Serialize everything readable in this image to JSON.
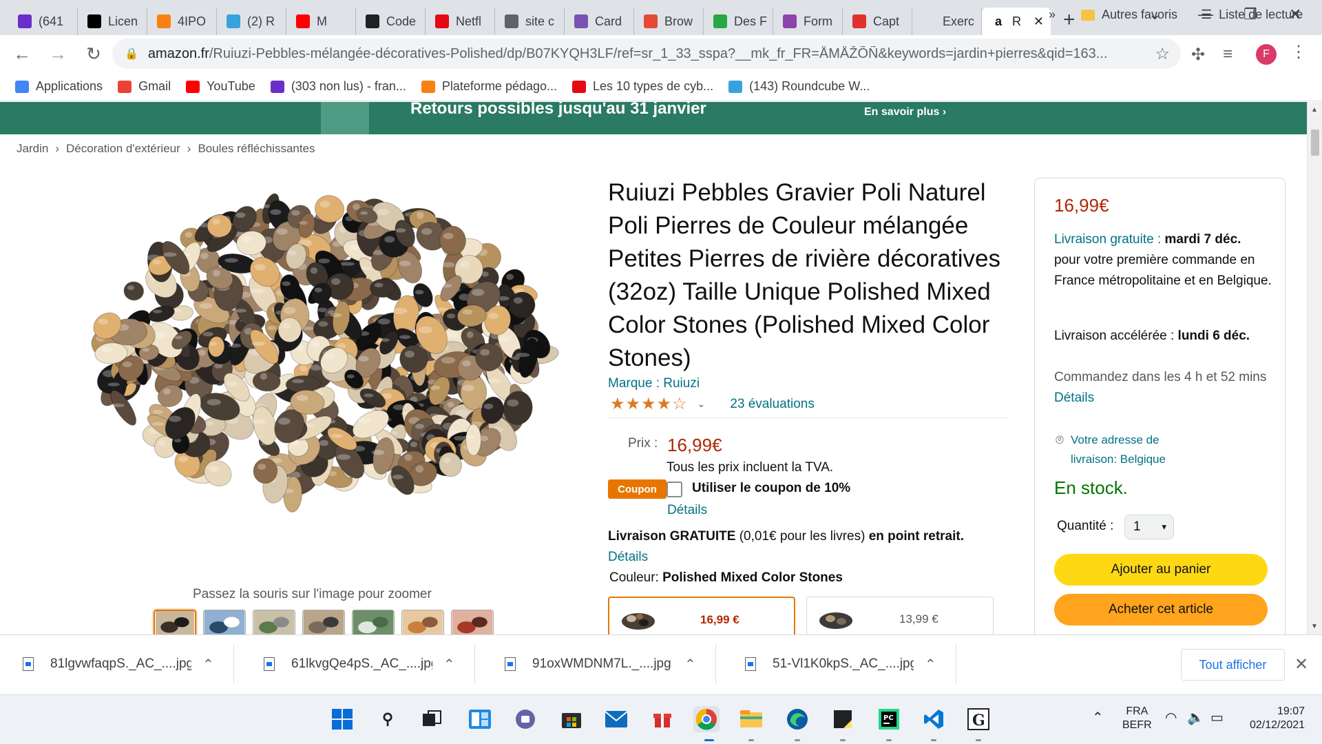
{
  "browser": {
    "tabs": [
      {
        "title": "(641",
        "icon": "mail-icon",
        "color": "#6b2fc9"
      },
      {
        "title": "Licen",
        "icon": "jb-icon",
        "color": "#000000"
      },
      {
        "title": "4IPO",
        "icon": "moodle-icon",
        "color": "#f98012"
      },
      {
        "title": "(2) R",
        "icon": "roundcube-icon",
        "color": "#37a3dc"
      },
      {
        "title": "M",
        "icon": "youtube-icon",
        "color": "#ff0000"
      },
      {
        "title": "Code",
        "icon": "codepen-icon",
        "color": "#202124"
      },
      {
        "title": "Netfl",
        "icon": "netflix-icon",
        "color": "#e50914"
      },
      {
        "title": "site c",
        "icon": "globe-icon",
        "color": "#5f6368"
      },
      {
        "title": "Card",
        "icon": "bootstrap-icon",
        "color": "#7952b3"
      },
      {
        "title": "Brow",
        "icon": "browserstack-icon",
        "color": "#e54a37"
      },
      {
        "title": "Des F",
        "icon": "px-icon",
        "color": "#28a745"
      },
      {
        "title": "Form",
        "icon": "form-icon",
        "color": "#8e44ad"
      },
      {
        "title": "Capt",
        "icon": "capture-icon",
        "color": "#e0322d"
      },
      {
        "title": "Exerc",
        "icon": "blank-icon",
        "color": "#dfe3e8"
      },
      {
        "title": "R",
        "icon": "amazon-icon",
        "color": "#ffffff",
        "active": true
      }
    ],
    "url_host": "amazon.fr",
    "url_path": "/Ruiuzi-Pebbles-mélangée-décoratives-Polished/dp/B07KYQH3LF/ref=sr_1_33_sspa?__mk_fr_FR=ÅMÅŽÕÑ&keywords=jardin+pierres&qid=163...",
    "profile_initial": "F",
    "bookmarks": [
      {
        "label": "Applications",
        "icon": "apps-grid-icon"
      },
      {
        "label": "Gmail",
        "icon": "gmail-icon"
      },
      {
        "label": "YouTube",
        "icon": "youtube-icon"
      },
      {
        "label": "(303 non lus) - fran...",
        "icon": "mail-icon"
      },
      {
        "label": "Plateforme pédago...",
        "icon": "moodle-icon"
      },
      {
        "label": "Les 10 types de cyb...",
        "icon": "horseshoe-icon"
      },
      {
        "label": "(143) Roundcube W...",
        "icon": "roundcube-icon"
      }
    ],
    "bookmarks_right": {
      "more": "»",
      "folder": "Autres favoris",
      "reading": "Liste de lecture"
    }
  },
  "banner": {
    "main": "Retours possibles jusqu'au 31 janvier",
    "more": "En savoir plus ›"
  },
  "breadcrumb": [
    "Jardin",
    "Décoration d'extérieur",
    "Boules réfléchissantes"
  ],
  "product": {
    "title": "Ruiuzi Pebbles Gravier Poli Naturel Poli Pierres de Couleur mélangée Petites Pierres de rivière décoratives (32oz) Taille Unique Polished Mixed Color Stones (Polished Mixed Color Stones)",
    "brand": "Marque : Ruiuzi",
    "stars": "★★★★☆",
    "rating": 4,
    "reviews": "23 évaluations",
    "price_label": "Prix :",
    "price": "16,99€",
    "tva": "Tous les prix incluent la TVA.",
    "coupon_badge": "Coupon",
    "coupon_text": "Utiliser le coupon de 10%",
    "coupon_details": "Détails",
    "livraison_a": "Livraison GRATUITE",
    "livraison_b": " (0,01€ pour les livres) ",
    "livraison_c": "en point retrait.",
    "livraison_details": "Détails",
    "couleur_label": "Couleur: ",
    "couleur_value": "Polished Mixed Color Stones",
    "variants": [
      {
        "price": "16,99 €",
        "selected": true
      },
      {
        "price": "13,99 €",
        "selected": false
      }
    ],
    "zoom_hint": "Passez la souris sur l'image pour zoomer",
    "thumbnail_count": 7
  },
  "buybox": {
    "price": "16,99€",
    "free_link": "Livraison gratuite :",
    "free_date": " mardi 7 déc.",
    "free_rest": "pour votre première commande en France métropolitaine et en Belgique.",
    "fast_a": "Livraison accélérée : ",
    "fast_b": "lundi 6 déc.",
    "order_a": "Commandez dans les 4 h et 52 mins ",
    "order_link": "Détails",
    "address": "Votre adresse de livraison: Belgique",
    "stock": "En stock.",
    "qty_label": "Quantité :",
    "qty_value": "1",
    "add_to_cart": "Ajouter au panier",
    "buy_now": "Acheter cet article"
  },
  "downloads": {
    "files": [
      "81lgvwfaqpS._AC_....jpg",
      "61lkvgQe4pS._AC_....jpg",
      "91oxWMDNM7L._....jpg",
      "51-Vl1K0kpS._AC_....jpg"
    ],
    "show_all": "Tout afficher"
  },
  "taskbar": {
    "lang_top": "FRA",
    "lang_bottom": "BEFR",
    "time": "19:07",
    "date": "02/12/2021"
  }
}
